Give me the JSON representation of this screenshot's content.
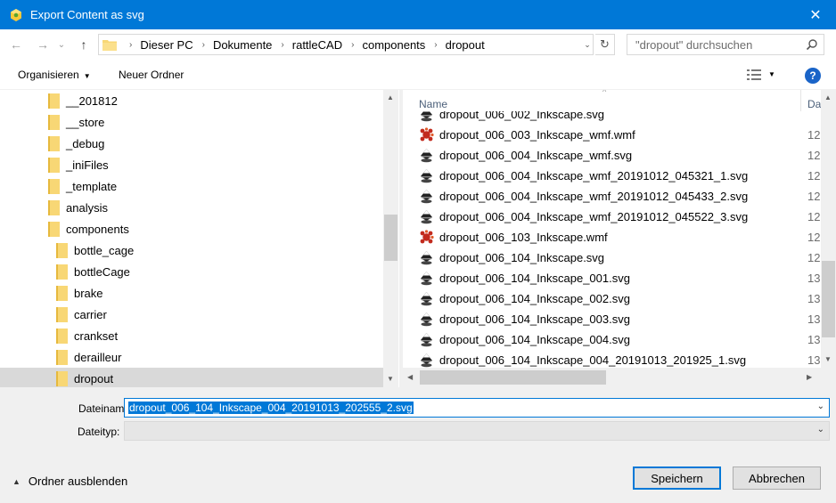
{
  "window": {
    "title": "Export Content as svg",
    "close_glyph": "✕"
  },
  "nav": {
    "back_glyph": "←",
    "forward_glyph": "→",
    "recent_glyph": "⌄",
    "up_glyph": "↑",
    "breadcrumbs": [
      "Dieser PC",
      "Dokumente",
      "rattleCAD",
      "components",
      "dropout"
    ],
    "breadcrumb_sep": "›",
    "dropdown_glyph": "⌄",
    "refresh_glyph": "↻",
    "search_placeholder": "\"dropout\" durchsuchen"
  },
  "toolbar": {
    "organize_label": "Organisieren",
    "organize_caret": "▼",
    "new_folder_label": "Neuer Ordner",
    "view_caret": "▼",
    "help_label": "?"
  },
  "tree": {
    "items": [
      {
        "label": "__201812",
        "indent": 1
      },
      {
        "label": "__store",
        "indent": 1
      },
      {
        "label": "_debug",
        "indent": 1
      },
      {
        "label": "_iniFiles",
        "indent": 1
      },
      {
        "label": "_template",
        "indent": 1
      },
      {
        "label": "analysis",
        "indent": 1
      },
      {
        "label": "components",
        "indent": 1
      },
      {
        "label": "bottle_cage",
        "indent": 2
      },
      {
        "label": "bottleCage",
        "indent": 2
      },
      {
        "label": "brake",
        "indent": 2
      },
      {
        "label": "carrier",
        "indent": 2
      },
      {
        "label": "crankset",
        "indent": 2
      },
      {
        "label": "derailleur",
        "indent": 2
      },
      {
        "label": "dropout",
        "indent": 2,
        "selected": true
      }
    ]
  },
  "file_list": {
    "col_name": "Name",
    "col_date": "Da",
    "sort_glyph": "^",
    "files": [
      {
        "name": "dropout_006_002_Inkscape.svg",
        "type": "svg",
        "date": ""
      },
      {
        "name": "dropout_006_003_Inkscape_wmf.wmf",
        "type": "wmf",
        "date": "12"
      },
      {
        "name": "dropout_006_004_Inkscape_wmf.svg",
        "type": "svg",
        "date": "12"
      },
      {
        "name": "dropout_006_004_Inkscape_wmf_20191012_045321_1.svg",
        "type": "svg",
        "date": "12"
      },
      {
        "name": "dropout_006_004_Inkscape_wmf_20191012_045433_2.svg",
        "type": "svg",
        "date": "12"
      },
      {
        "name": "dropout_006_004_Inkscape_wmf_20191012_045522_3.svg",
        "type": "svg",
        "date": "12"
      },
      {
        "name": "dropout_006_103_Inkscape.wmf",
        "type": "wmf",
        "date": "12"
      },
      {
        "name": "dropout_006_104_Inkscape.svg",
        "type": "svg",
        "date": "12"
      },
      {
        "name": "dropout_006_104_Inkscape_001.svg",
        "type": "svg",
        "date": "13"
      },
      {
        "name": "dropout_006_104_Inkscape_002.svg",
        "type": "svg",
        "date": "13"
      },
      {
        "name": "dropout_006_104_Inkscape_003.svg",
        "type": "svg",
        "date": "13"
      },
      {
        "name": "dropout_006_104_Inkscape_004.svg",
        "type": "svg",
        "date": "13"
      },
      {
        "name": "dropout_006_104_Inkscape_004_20191013_201925_1.svg",
        "type": "svg",
        "date": "13"
      }
    ]
  },
  "fields": {
    "filename_label": "Dateiname:",
    "filename_value": "dropout_006_104_Inkscape_004_20191013_202555_2.svg",
    "filetype_label": "Dateityp:",
    "filetype_value": "",
    "dropdown_glyph": "⌄"
  },
  "footer": {
    "hide_folders_label": "Ordner ausblenden",
    "hide_caret": "▲",
    "save_label": "Speichern",
    "cancel_label": "Abbrechen"
  },
  "colors": {
    "accent": "#0078d7",
    "folder": "#f8d775",
    "selection": "#d9d9d9"
  }
}
